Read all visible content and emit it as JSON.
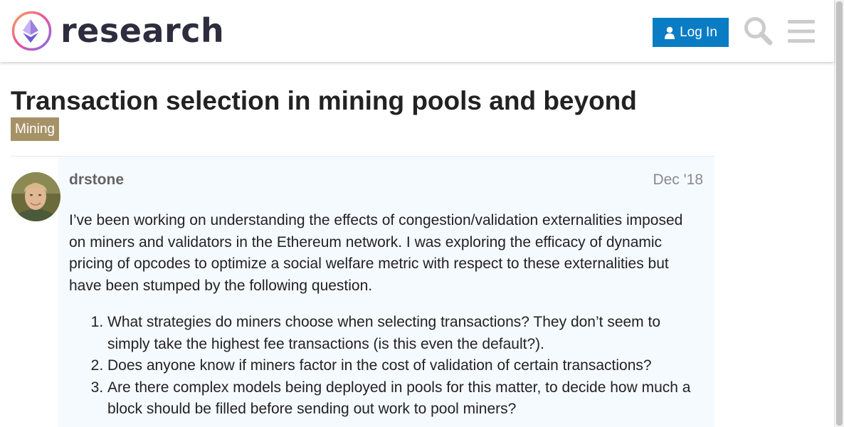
{
  "header": {
    "logo_text": "research",
    "login_label": "Log In",
    "colors": {
      "login_bg": "#0a7cc4",
      "icon_gray": "#cccccc"
    }
  },
  "topic": {
    "title": "Transaction selection in mining pools and beyond",
    "category": "Mining",
    "category_color": "#a59266"
  },
  "post": {
    "username": "drstone",
    "date": "Dec '18",
    "paragraph": "I’ve been working on understanding the effects of congestion/validation externalities imposed on miners and validators in the Ethereum network. I was exploring the efficacy of dynamic pricing of opcodes to optimize a social welfare metric with respect to these externalities but have been stumped by the following question.",
    "questions": [
      "What strategies do miners choose when selecting transactions? They don’t seem to simply take the highest fee transactions (is this even the default?).",
      "Does anyone know if miners factor in the cost of validation of certain transactions?",
      "Are there complex models being deployed in pools for this matter, to decide how much a block should be filled before sending out work to pool miners?"
    ]
  }
}
